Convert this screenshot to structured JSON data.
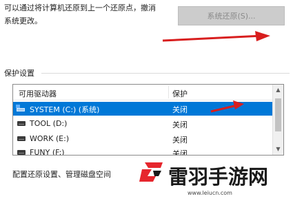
{
  "description": {
    "line1": "可以通过将计算机还原到上一个还原点，撤消",
    "line2": "系统更改。"
  },
  "restore_button": {
    "label": "系统还原(S)..."
  },
  "protection": {
    "group_title": "保护设置",
    "columns": [
      "可用驱动器",
      "保护"
    ],
    "drives": [
      {
        "name": "SYSTEM (C:) (系统)",
        "protection": "关闭",
        "icon": "system-drive-icon",
        "selected": true
      },
      {
        "name": "TOOL (D:)",
        "protection": "关闭",
        "icon": "drive-icon",
        "selected": false
      },
      {
        "name": "WORK (E:)",
        "protection": "关闭",
        "icon": "drive-icon",
        "selected": false
      },
      {
        "name": "FUNY (F:)",
        "protection": "关闭",
        "icon": "drive-icon",
        "selected": false
      }
    ],
    "scroll_up": "▲",
    "scroll_down": "▼"
  },
  "footer": {
    "text": "配置还原设置、管理磁盘空间"
  },
  "watermark": {
    "brand": "雷羽手游网",
    "url": "www.leiucn.com"
  },
  "colors": {
    "selection": "#0078d7",
    "annotation_arrow": "#d81e1e",
    "logo_red": "#e6262d"
  }
}
